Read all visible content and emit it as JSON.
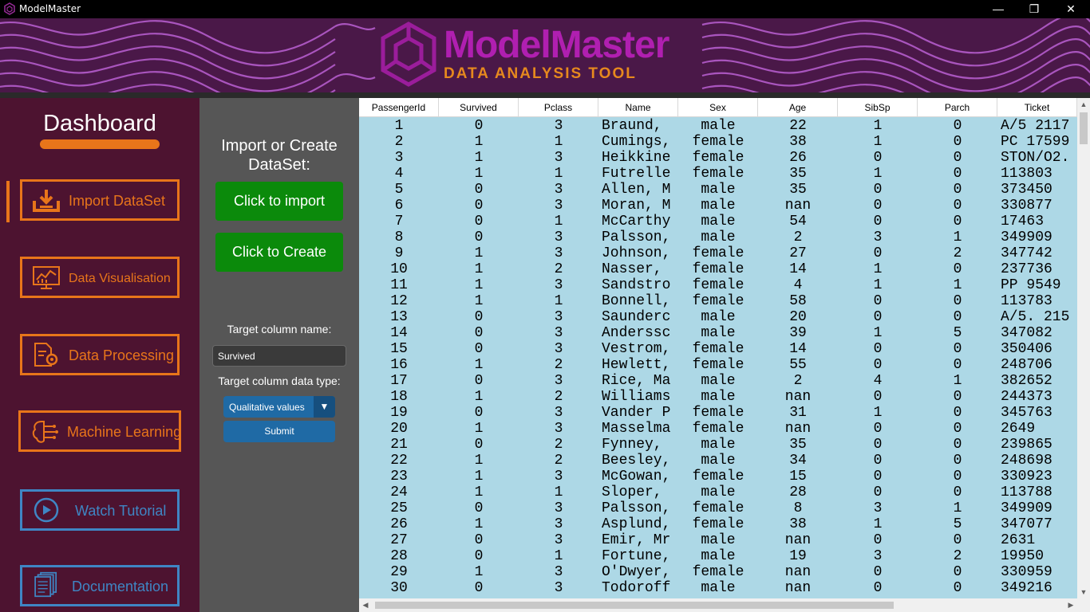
{
  "window": {
    "title": "ModelMaster",
    "minimize": "—",
    "maximize": "❐",
    "close": "✕"
  },
  "banner": {
    "title": "ModelMaster",
    "subtitle": "DATA ANALYSIS TOOL"
  },
  "sidebar": {
    "title": "Dashboard",
    "items": [
      {
        "label": "Import DataSet",
        "icon": "download-icon"
      },
      {
        "label": "Data Visualisation",
        "icon": "chart-monitor-icon"
      },
      {
        "label": "Data Processing",
        "icon": "document-gear-icon"
      },
      {
        "label": "Machine Learning",
        "icon": "brain-circuit-icon"
      },
      {
        "label": "Watch Tutorial",
        "icon": "play-icon"
      },
      {
        "label": "Documentation",
        "icon": "documents-icon"
      }
    ]
  },
  "panel": {
    "title": "Import or Create DataSet:",
    "import_button": "Click to import",
    "create_button": "Click to Create",
    "target_name_label": "Target column name:",
    "target_name_value": "Survived",
    "target_type_label": "Target column data type:",
    "target_type_value": "Qualitative values",
    "submit": "Submit"
  },
  "table": {
    "columns": [
      "PassengerId",
      "Survived",
      "Pclass",
      "Name",
      "Sex",
      "Age",
      "SibSp",
      "Parch",
      "Ticket"
    ],
    "rows": [
      [
        "1",
        "0",
        "3",
        "Braund,",
        "male",
        "22",
        "1",
        "0",
        "A/5 2117"
      ],
      [
        "2",
        "1",
        "1",
        "Cumings,",
        "female",
        "38",
        "1",
        "0",
        "PC 17599"
      ],
      [
        "3",
        "1",
        "3",
        "Heikkine",
        "female",
        "26",
        "0",
        "0",
        "STON/O2."
      ],
      [
        "4",
        "1",
        "1",
        "Futrelle",
        "female",
        "35",
        "1",
        "0",
        "113803"
      ],
      [
        "5",
        "0",
        "3",
        "Allen, M",
        "male",
        "35",
        "0",
        "0",
        "373450"
      ],
      [
        "6",
        "0",
        "3",
        "Moran, M",
        "male",
        "nan",
        "0",
        "0",
        "330877"
      ],
      [
        "7",
        "0",
        "1",
        "McCarthy",
        "male",
        "54",
        "0",
        "0",
        "17463"
      ],
      [
        "8",
        "0",
        "3",
        "Palsson,",
        "male",
        "2",
        "3",
        "1",
        "349909"
      ],
      [
        "9",
        "1",
        "3",
        "Johnson,",
        "female",
        "27",
        "0",
        "2",
        "347742"
      ],
      [
        "10",
        "1",
        "2",
        "Nasser,",
        "female",
        "14",
        "1",
        "0",
        "237736"
      ],
      [
        "11",
        "1",
        "3",
        "Sandstro",
        "female",
        "4",
        "1",
        "1",
        "PP 9549"
      ],
      [
        "12",
        "1",
        "1",
        "Bonnell,",
        "female",
        "58",
        "0",
        "0",
        "113783"
      ],
      [
        "13",
        "0",
        "3",
        "Saunderc",
        "male",
        "20",
        "0",
        "0",
        "A/5. 215"
      ],
      [
        "14",
        "0",
        "3",
        "Anderssc",
        "male",
        "39",
        "1",
        "5",
        "347082"
      ],
      [
        "15",
        "0",
        "3",
        "Vestrom,",
        "female",
        "14",
        "0",
        "0",
        "350406"
      ],
      [
        "16",
        "1",
        "2",
        "Hewlett,",
        "female",
        "55",
        "0",
        "0",
        "248706"
      ],
      [
        "17",
        "0",
        "3",
        "Rice, Ma",
        "male",
        "2",
        "4",
        "1",
        "382652"
      ],
      [
        "18",
        "1",
        "2",
        "Williams",
        "male",
        "nan",
        "0",
        "0",
        "244373"
      ],
      [
        "19",
        "0",
        "3",
        "Vander P",
        "female",
        "31",
        "1",
        "0",
        "345763"
      ],
      [
        "20",
        "1",
        "3",
        "Masselma",
        "female",
        "nan",
        "0",
        "0",
        "2649"
      ],
      [
        "21",
        "0",
        "2",
        "Fynney,",
        "male",
        "35",
        "0",
        "0",
        "239865"
      ],
      [
        "22",
        "1",
        "2",
        "Beesley,",
        "male",
        "34",
        "0",
        "0",
        "248698"
      ],
      [
        "23",
        "1",
        "3",
        "McGowan,",
        "female",
        "15",
        "0",
        "0",
        "330923"
      ],
      [
        "24",
        "1",
        "1",
        "Sloper,",
        "male",
        "28",
        "0",
        "0",
        "113788"
      ],
      [
        "25",
        "0",
        "3",
        "Palsson,",
        "female",
        "8",
        "3",
        "1",
        "349909"
      ],
      [
        "26",
        "1",
        "3",
        "Asplund,",
        "female",
        "38",
        "1",
        "5",
        "347077"
      ],
      [
        "27",
        "0",
        "3",
        "Emir, Mr",
        "male",
        "nan",
        "0",
        "0",
        "2631"
      ],
      [
        "28",
        "0",
        "1",
        "Fortune,",
        "male",
        "19",
        "3",
        "2",
        "19950"
      ],
      [
        "29",
        "1",
        "3",
        "O'Dwyer,",
        "female",
        "nan",
        "0",
        "0",
        "330959"
      ],
      [
        "30",
        "0",
        "3",
        "Todoroff",
        "male",
        "nan",
        "0",
        "0",
        "349216"
      ]
    ]
  },
  "colors": {
    "accent_orange": "#e8751a",
    "accent_blue": "#3f86c4",
    "sidebar_bg": "#4d1330",
    "table_bg": "#add8e6",
    "green_button": "#0b8a0b"
  }
}
